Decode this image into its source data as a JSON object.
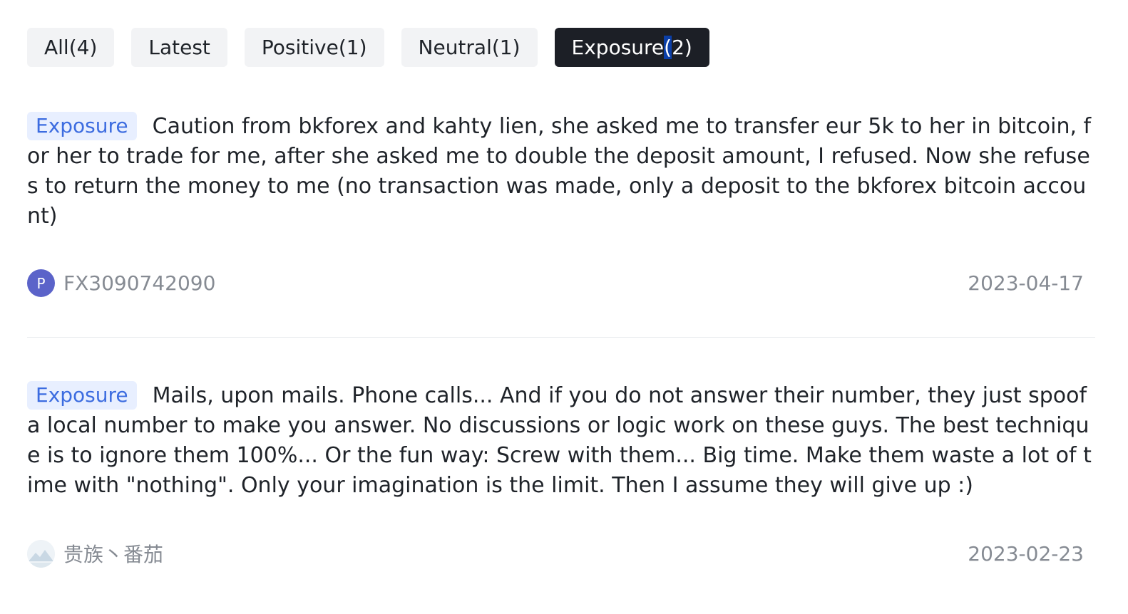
{
  "tabs": [
    {
      "label": "All(4)"
    },
    {
      "label": "Latest"
    },
    {
      "label": "Positive(1)"
    },
    {
      "label": "Neutral(1)"
    },
    {
      "label_pre": "Exposure",
      "label_sel": "(",
      "label_post": "2)"
    }
  ],
  "reviews": [
    {
      "tag": "Exposure",
      "text": "Caution from bkforex and kahty lien, she asked me to transfer eur 5k to her in bitcoin, for her to trade for me, after she asked me to double the deposit amount, I refused. Now she refuses to return the money to me (no transaction was made, only a deposit to the bkforex bitcoin account)",
      "author": "FX3090742090",
      "avatar_letter": "P",
      "date": "2023-04-17"
    },
    {
      "tag": "Exposure",
      "text": "Mails, upon mails. Phone calls... And if you do not answer their number, they just spoof a local number to make you answer. No discussions or logic work on these guys. The best technique is to ignore them 100%... Or the fun way: Screw with them... Big time. Make them waste a lot of time with \"nothing\". Only your imagination is the limit. Then I assume they will give up :)",
      "author": "贵族丶番茄",
      "date": "2023-02-23"
    }
  ],
  "colors": {
    "active_tab_bg": "#1c1f26",
    "tag_bg": "#e8efff",
    "tag_text": "#3c6ce0",
    "avatar_bg": "#5b63c9"
  }
}
